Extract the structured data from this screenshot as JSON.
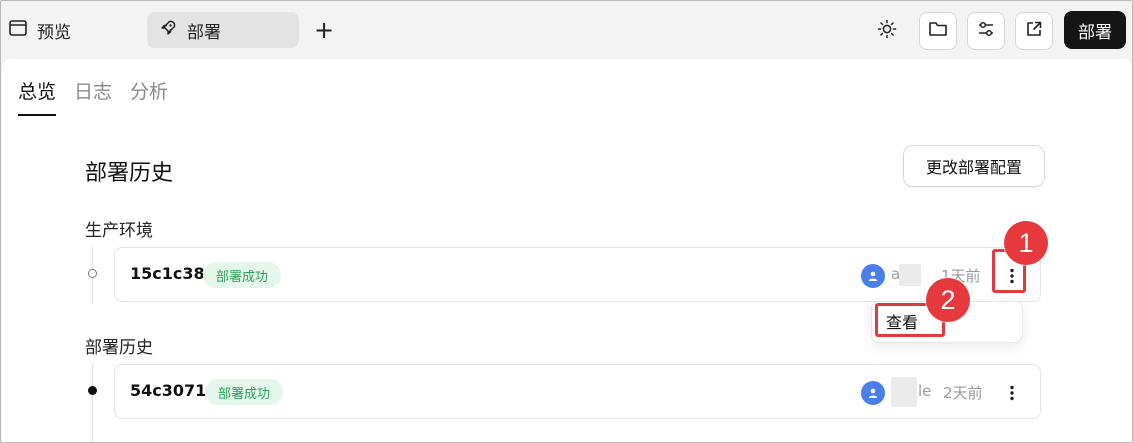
{
  "topbar": {
    "preview_label": "预览",
    "deploy_tab_label": "部署",
    "add_label": "+",
    "deploy_button_label": "部署"
  },
  "subtabs": [
    {
      "label": "总览",
      "active": true
    },
    {
      "label": "日志",
      "active": false
    },
    {
      "label": "分析",
      "active": false
    }
  ],
  "section": {
    "title": "部署历史",
    "config_button": "更改部署配置"
  },
  "production": {
    "label": "生产环境",
    "commit": "15c1c38",
    "status": "部署成功",
    "user_visible": "a e",
    "time": "1天前"
  },
  "history": {
    "label": "部署历史",
    "commit": "54c3071",
    "status": "部署成功",
    "user_visible": "le",
    "time": "2天前"
  },
  "menu": {
    "view_label": "查看"
  },
  "annotations": {
    "marker1": "1",
    "marker2": "2"
  },
  "colors": {
    "accent_dark": "#151515",
    "success_bg": "#e4f7ea",
    "success_text": "#2ea05a",
    "avatar": "#4a7fe8",
    "annotation_red": "#e0393e"
  }
}
